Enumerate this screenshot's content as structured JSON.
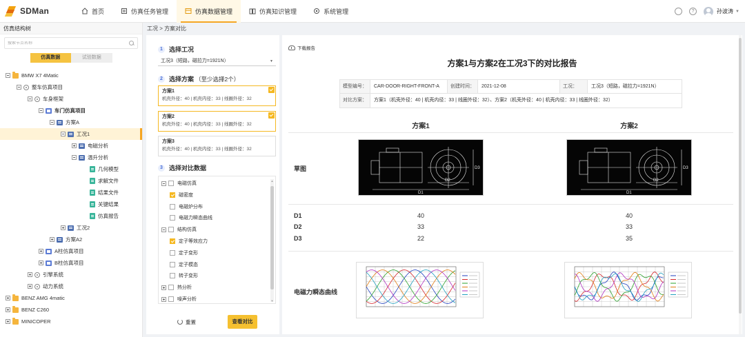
{
  "app": {
    "name": "SDMan"
  },
  "nav": [
    {
      "label": "首页",
      "active": false
    },
    {
      "label": "仿真任务管理",
      "active": false
    },
    {
      "label": "仿真数据管理",
      "active": true
    },
    {
      "label": "仿真知识管理",
      "active": false
    },
    {
      "label": "系统管理",
      "active": false
    }
  ],
  "user": {
    "name": "孙波涛"
  },
  "left": {
    "title": "仿真结构树",
    "search_placeholder": "搜索节点名称",
    "toggle": {
      "on": "仿真数据",
      "off": "试验数据"
    },
    "tree": [
      {
        "label": "BMW X7 4Matic",
        "level": 0,
        "icon": "folder",
        "exp": "minus"
      },
      {
        "label": "整车仿真项目",
        "level": 1,
        "icon": "gear",
        "exp": "minus"
      },
      {
        "label": "车身框架",
        "level": 2,
        "icon": "gear",
        "exp": "minus"
      },
      {
        "label": "车门仿真项目",
        "level": 3,
        "icon": "proj",
        "exp": "minus",
        "bold": true
      },
      {
        "label": "方案A",
        "level": 4,
        "icon": "cond",
        "exp": "minus"
      },
      {
        "label": "工况1",
        "level": 5,
        "icon": "cond",
        "exp": "minus",
        "selected": true
      },
      {
        "label": "电磁分析",
        "level": 6,
        "icon": "cond",
        "exp": "plus"
      },
      {
        "label": "温升分析",
        "level": 6,
        "icon": "cond",
        "exp": "minus"
      },
      {
        "label": "几何模型",
        "level": 7,
        "icon": "file",
        "exp": "none"
      },
      {
        "label": "求解文件",
        "level": 7,
        "icon": "file",
        "exp": "none"
      },
      {
        "label": "结果文件",
        "level": 7,
        "icon": "file",
        "exp": "none"
      },
      {
        "label": "关键结果",
        "level": 7,
        "icon": "file",
        "exp": "none"
      },
      {
        "label": "仿真报告",
        "level": 7,
        "icon": "file",
        "exp": "none"
      },
      {
        "label": "工况2",
        "level": 5,
        "icon": "cond",
        "exp": "plus"
      },
      {
        "label": "方案A2",
        "level": 4,
        "icon": "cond",
        "exp": "plus"
      },
      {
        "label": "A柱仿真项目",
        "level": 3,
        "icon": "proj",
        "exp": "plus"
      },
      {
        "label": "B柱仿真项目",
        "level": 3,
        "icon": "proj",
        "exp": "plus"
      },
      {
        "label": "引擎系统",
        "level": 2,
        "icon": "gear",
        "exp": "plus"
      },
      {
        "label": "动力系统",
        "level": 2,
        "icon": "gear",
        "exp": "plus"
      },
      {
        "label": "BENZ AMG 4matic",
        "level": 0,
        "icon": "folder",
        "exp": "plus"
      },
      {
        "label": "BENZ C260",
        "level": 0,
        "icon": "folder",
        "exp": "plus"
      },
      {
        "label": "MINICOPER",
        "level": 0,
        "icon": "folder",
        "exp": "plus"
      }
    ]
  },
  "breadcrumb": "工况 > 方案对比",
  "mid": {
    "step1": {
      "num": "1",
      "title": "选择工况"
    },
    "condition_value": "工况3（短路，磁拉力=1921N）",
    "step2": {
      "num": "2",
      "title": "选择方案",
      "sub": "（至少选择2个）"
    },
    "plans": [
      {
        "name": "方案1",
        "detail": "机壳外径：40 | 机壳内径：33 | 线圈外径：32",
        "checked": true
      },
      {
        "name": "方案2",
        "detail": "机壳外径：40 | 机壳内径：33 | 线圈外径：32",
        "checked": true
      },
      {
        "name": "方案3",
        "detail": "机壳外径：40 | 机壳内径：33 | 线圈外径：32",
        "checked": false
      }
    ],
    "step3": {
      "num": "3",
      "title": "选择对比数据"
    },
    "data_tree": [
      {
        "label": "电磁仿真",
        "level": 0,
        "exp": "minus",
        "checked": false
      },
      {
        "label": "磁密度",
        "level": 1,
        "exp": "none",
        "checked": true
      },
      {
        "label": "电磁炉分布",
        "level": 1,
        "exp": "none",
        "checked": false
      },
      {
        "label": "电磁力瞬态曲线",
        "level": 1,
        "exp": "none",
        "checked": false
      },
      {
        "label": "结构仿真",
        "level": 0,
        "exp": "minus",
        "checked": false
      },
      {
        "label": "定子等效应力",
        "level": 1,
        "exp": "none",
        "checked": true
      },
      {
        "label": "定子变形",
        "level": 1,
        "exp": "none",
        "checked": false
      },
      {
        "label": "定子模态",
        "level": 1,
        "exp": "none",
        "checked": false
      },
      {
        "label": "转子变形",
        "level": 1,
        "exp": "none",
        "checked": false
      },
      {
        "label": "热分析",
        "level": 0,
        "exp": "plus",
        "checked": false
      },
      {
        "label": "噪声分析",
        "level": 0,
        "exp": "plus",
        "checked": false
      }
    ],
    "reset_label": "重置",
    "compare_label": "查看对比"
  },
  "report": {
    "download_label": "下载报告",
    "title": "方案1与方案2在工况3下的对比报告",
    "meta": {
      "model_key": "模型编号：",
      "model_val": "CAR-DOOR-RIGHT-FRONT-A",
      "created_key": "创建时间：",
      "created_val": "2021-12-08",
      "cond_key": "工况：",
      "cond_val": "工况3（短路，磁拉力=1921N）",
      "plans_key": "对比方案：",
      "plans_val": "方案1（机壳外径：40 | 机壳内径：33 | 线圈外径：32）、方案2（机壳外径：40 | 机壳内径：33 | 线圈外径：32）"
    },
    "col1": "方案1",
    "col2": "方案2",
    "sketch_label": "草图",
    "dims": [
      {
        "label": "D1",
        "v1": "40",
        "v2": "40"
      },
      {
        "label": "D2",
        "v1": "33",
        "v2": "33"
      },
      {
        "label": "D3",
        "v1": "22",
        "v2": "35"
      }
    ],
    "curve_label": "电磁力瞬态曲线",
    "cad_labels": {
      "d1": "D1",
      "d2": "D2",
      "d3": "D3"
    }
  }
}
